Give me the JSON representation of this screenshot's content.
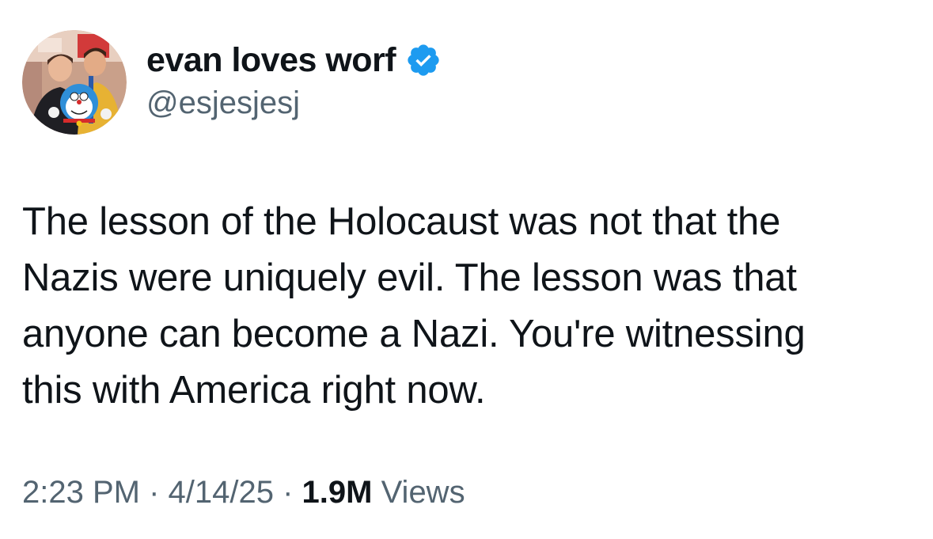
{
  "author": {
    "display_name": "evan loves worf",
    "handle": "@esjesjesj",
    "verified_icon": "verified-badge-icon",
    "verified_color": "#1d9bf0"
  },
  "tweet": {
    "lines": [
      "The lesson of the Holocaust was not that the",
      "Nazis were uniquely evil. The lesson was that",
      "anyone can become a Nazi. You're witnessing",
      "this with America right now."
    ]
  },
  "meta": {
    "time": "2:23 PM",
    "separator": " · ",
    "date": "4/14/25",
    "views_count": "1.9M",
    "views_label": "Views"
  },
  "colors": {
    "text": "#0f1419",
    "secondary": "#536471",
    "accent": "#1d9bf0"
  }
}
